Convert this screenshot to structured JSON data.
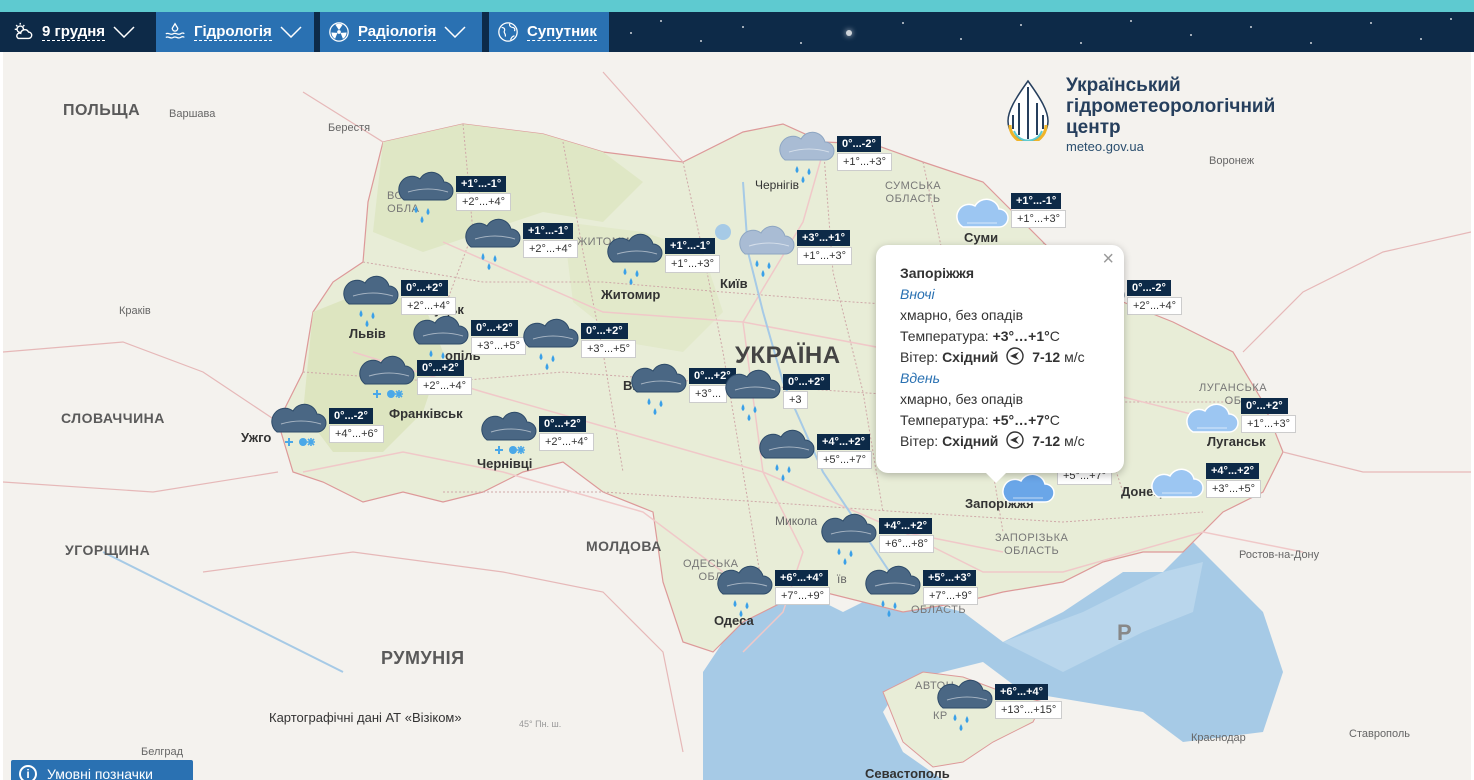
{
  "nav": {
    "date_label": "9 грудня",
    "hydrology_label": "Гідрологія",
    "radiology_label": "Радіологія",
    "satellite_label": "Супутник"
  },
  "logo": {
    "line1": "Український",
    "line2": "гідрометеорологічний",
    "line3": "центр",
    "url": "meteo.gov.ua"
  },
  "countries": {
    "poland": "ПОЛЬЩА",
    "slovakia": "СЛОВАЧЧИНА",
    "hungary": "УГОРЩИНА",
    "moldova": "МОЛДОВА",
    "romania": "РУМУНІЯ",
    "ukraine": "УКРАЇНА"
  },
  "cities_minor": {
    "warsaw": "Варшава",
    "brest": "Берестя",
    "krakow": "Краків",
    "voronezh": "Воронеж",
    "rostov": "Ростов-на-Дону",
    "krasnodar": "Краснодар",
    "stavropol": "Ставрополь",
    "belgrade": "Белград"
  },
  "cities_major": {
    "lutsk": "Луцьк",
    "lviv": "Львів",
    "zhytomyr": "Житомир",
    "kyiv": "Київ",
    "chernihiv": "Чернігів",
    "sumy": "Суми",
    "uzhhorod": "Ужго",
    "frankivsk": "Франківськ",
    "ternopil": "опіль",
    "chernivtsi": "Чернівці",
    "vinnytsia": "Вінн",
    "odesa": "Одеса",
    "zaporizhzhia": "Запоріжжя",
    "donetsk": "Донецьк",
    "luhansk": "Луганськ",
    "sevastopol": "Севастополь",
    "mykolaiv": "Микола",
    "kherson": "їв"
  },
  "oblasts": {
    "volyn": "ВОЛИ\nОБЛА",
    "sumy": "СУМСЬКА\nОБЛАСТЬ",
    "zap": "ЗАПОРІЗЬКА\nОБЛАСТЬ",
    "luh": "ЛУГАНСЬКА\nОБ",
    "odesa": "ОДЕСЬКА\nОБЛ",
    "kherson_obl": "ОБЛАСТЬ",
    "zhyt": "ЖИТОМИ",
    "crimea1": "АВТОН",
    "crimea2": "КР"
  },
  "forecasts": [
    {
      "night": "+1°...-1°",
      "day": "+2°...+4°",
      "kind": "rain"
    },
    {
      "night": "+1°...-1°",
      "day": "+2°...+4°",
      "kind": "rain"
    },
    {
      "night": "+1°...-1°",
      "day": "+1°...+3°",
      "kind": "rain"
    },
    {
      "night": "0°...-2°",
      "day": "+1°...+3°",
      "kind": "rain-light"
    },
    {
      "night": "+3°...+1°",
      "day": "+1°...+3°",
      "kind": "rain-light"
    },
    {
      "night": "+1°...-1°",
      "day": "+1°...+3°",
      "kind": "cloud-light"
    },
    {
      "night": "0°...+2°",
      "day": "+2°...+4°",
      "kind": "rain"
    },
    {
      "night": "0°...+2°",
      "day": "+3°...+5°",
      "kind": "rain"
    },
    {
      "night": "0°...+2°",
      "day": "+3°...+5°",
      "kind": "rain"
    },
    {
      "night": "0°...+2°",
      "day": "+2°...+4°",
      "kind": "snow"
    },
    {
      "night": "0°...-2°",
      "day": "+4°...+6°",
      "kind": "snow"
    },
    {
      "night": "0°...+2°",
      "day": "+2°...+4°",
      "kind": "snow"
    },
    {
      "night": "0°...+2°",
      "day": "+3°...",
      "kind": "rain"
    },
    {
      "night": "0°...+2°",
      "day": "+3",
      "kind": "rain"
    },
    {
      "night": "+4°...+2°",
      "day": "+5°...+7°",
      "kind": "rain"
    },
    {
      "night": "0°...-2°",
      "day": "+2°...+4°",
      "kind": "rain"
    },
    {
      "night": "0°...+2°",
      "day": "+1°...+3°",
      "kind": "cloud-light"
    },
    {
      "night": "+4°...+2°",
      "day": "+3°...+5°",
      "kind": "cloud-light"
    },
    {
      "night": "",
      "day": "+5°...+7°",
      "kind": "cloud"
    },
    {
      "night": "+4°...+2°",
      "day": "+6°...+8°",
      "kind": "rain"
    },
    {
      "night": "+6°...+4°",
      "day": "+7°...+9°",
      "kind": "rain"
    },
    {
      "night": "+5°...+3°",
      "day": "+7°...+9°",
      "kind": "rain"
    },
    {
      "night": "+6°...+4°",
      "day": "+13°...+15°",
      "kind": "rain"
    }
  ],
  "popup": {
    "city": "Запоріжжя",
    "night_title": "Вночі",
    "night_desc": "хмарно, без опадів",
    "temp_label": "Температура:",
    "night_temp": "+3°…+1°",
    "unit": "С",
    "wind_label": "Вітер:",
    "wind_dir": "Східний",
    "night_wind": "7-12",
    "wind_unit": "м/с",
    "day_title": "Вдень",
    "day_desc": "хмарно, без опадів",
    "day_temp": "+5°…+7°",
    "day_wind": "7-12",
    "close": "×"
  },
  "attribution": "Картографічні дані АТ «Візіком»",
  "graticule": "45° Пн. ш.",
  "legend_label": "Умовні позначки",
  "colors": {
    "nav_bg": "#0d2a48",
    "nav_btn": "#2a71b2",
    "strip": "#5ecad0",
    "sea": "#a6cae6",
    "ukraine": "#e8edd7"
  }
}
